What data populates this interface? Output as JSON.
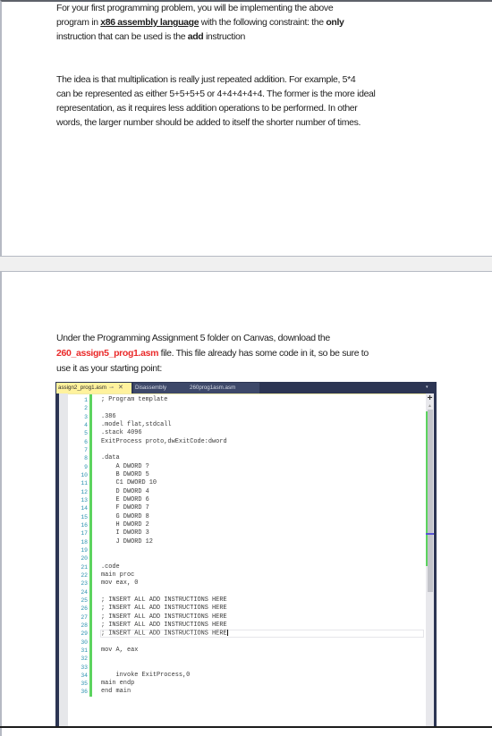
{
  "page1": {
    "paragraph1": {
      "line1": "For your first programming problem, you will be implementing the above",
      "line2_a": "program in ",
      "line2_emph": "x86 assembly language",
      "line2_b": " with the following constraint: the ",
      "line2_bold": "only",
      "line3_a": "instruction that can be used is the ",
      "line3_bold": "add",
      "line3_b": " instruction"
    },
    "paragraph2": {
      "lines": [
        "The idea is that multiplication is really just repeated addition. For example, 5*4",
        "can be represented as either 5+5+5+5 or 4+4+4+4+4. The former is the more ideal",
        "representation, as it requires less addition operations to be performed. In other",
        "words, the larger number should be added to itself the shorter number of times."
      ]
    }
  },
  "page2": {
    "paragraph3": {
      "line1": "Under the Programming Assignment 5 folder on Canvas, download the",
      "line2_filename": "260_assign5_prog1.asm",
      "line2_rest": " file. This file already has some code in it, so be sure to",
      "line3": "use it as your starting point:"
    }
  },
  "editor": {
    "tabs": [
      {
        "label": "assign2_prog1.asm",
        "active": true,
        "pin_icon": "⊸",
        "close_icon": "✕"
      },
      {
        "label": "Disassembly",
        "active": false
      },
      {
        "label": "260prog1asm.asm",
        "active": false
      }
    ],
    "dropdown_icon": "▾",
    "split_icon": "+",
    "scroll_up_icon": "▲",
    "current_line": 29,
    "lines": [
      {
        "n": 1,
        "code": "; Program template"
      },
      {
        "n": 2,
        "code": ""
      },
      {
        "n": 3,
        "code": ".386"
      },
      {
        "n": 4,
        "code": ".model flat,stdcall"
      },
      {
        "n": 5,
        "code": ".stack 4096"
      },
      {
        "n": 6,
        "code": "ExitProcess proto,dwExitCode:dword"
      },
      {
        "n": 7,
        "code": ""
      },
      {
        "n": 8,
        "code": ".data"
      },
      {
        "n": 9,
        "code": "    A DWORD ?"
      },
      {
        "n": 10,
        "code": "    B DWORD 5"
      },
      {
        "n": 11,
        "code": "    C1 DWORD 10"
      },
      {
        "n": 12,
        "code": "    D DWORD 4"
      },
      {
        "n": 13,
        "code": "    E DWORD 6"
      },
      {
        "n": 14,
        "code": "    F DWORD 7"
      },
      {
        "n": 15,
        "code": "    G DWORD 8"
      },
      {
        "n": 16,
        "code": "    H DWORD 2"
      },
      {
        "n": 17,
        "code": "    I DWORD 3"
      },
      {
        "n": 18,
        "code": "    J DWORD 12"
      },
      {
        "n": 19,
        "code": ""
      },
      {
        "n": 20,
        "code": ""
      },
      {
        "n": 21,
        "code": ".code"
      },
      {
        "n": 22,
        "code": "main proc"
      },
      {
        "n": 23,
        "code": "mov eax, 0"
      },
      {
        "n": 24,
        "code": ""
      },
      {
        "n": 25,
        "code": "; INSERT ALL ADD INSTRUCTIONS HERE"
      },
      {
        "n": 26,
        "code": "; INSERT ALL ADD INSTRUCTIONS HERE"
      },
      {
        "n": 27,
        "code": "; INSERT ALL ADD INSTRUCTIONS HERE"
      },
      {
        "n": 28,
        "code": "; INSERT ALL ADD INSTRUCTIONS HERE"
      },
      {
        "n": 29,
        "code": "; INSERT ALL ADD INSTRUCTIONS HERE"
      },
      {
        "n": 30,
        "code": ""
      },
      {
        "n": 31,
        "code": "mov A, eax"
      },
      {
        "n": 32,
        "code": ""
      },
      {
        "n": 33,
        "code": ""
      },
      {
        "n": 34,
        "code": "    invoke ExitProcess,0"
      },
      {
        "n": 35,
        "code": "main endp"
      },
      {
        "n": 36,
        "code": "end main"
      }
    ]
  },
  "colors": {
    "text": "#1e1e1e",
    "filename_highlight": "#ea2a2a",
    "editor_chrome": "#2c3553",
    "active_tab": "#fff29d",
    "line_numbers": "#2b91af",
    "change_bar": "#5cd35f"
  }
}
